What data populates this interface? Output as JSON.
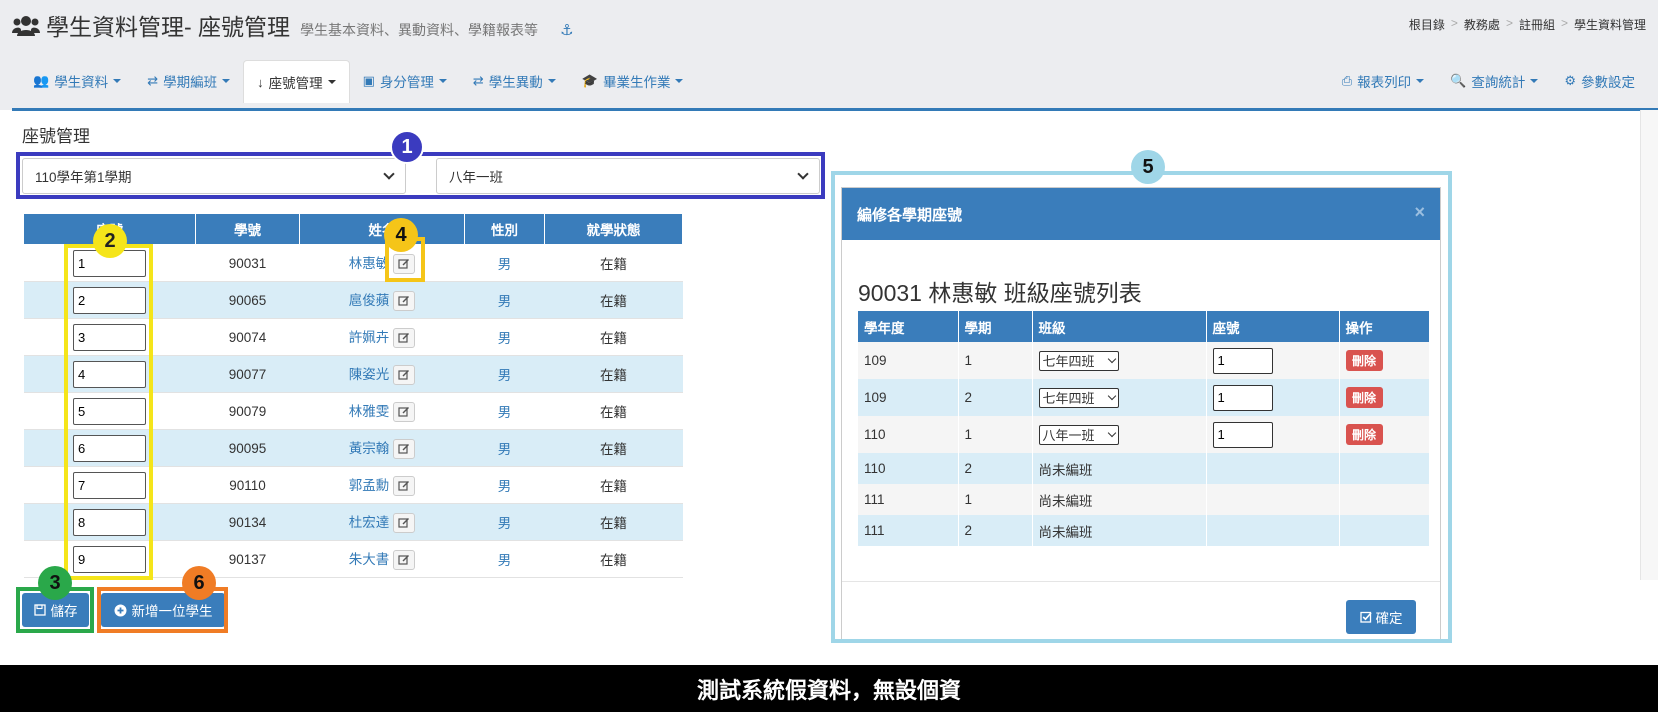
{
  "header": {
    "title": "學生資料管理- 座號管理",
    "subtitle": "學生基本資料、異動資料、學籍報表等",
    "anchor_icon": "anchor-icon",
    "breadcrumb": [
      "根目錄",
      "教務處",
      "註冊組",
      "學生資料管理"
    ]
  },
  "nav": {
    "left": [
      {
        "label": "學生資料",
        "icon": "users-icon",
        "glyph": "👥"
      },
      {
        "label": "學期編班",
        "icon": "shuffle-icon",
        "glyph": "⇄"
      },
      {
        "label": "座號管理",
        "icon": "sort-number-icon",
        "glyph": "↓"
      },
      {
        "label": "身分管理",
        "icon": "id-card-icon",
        "glyph": "▣"
      },
      {
        "label": "學生異動",
        "icon": "exchange-icon",
        "glyph": "⇄"
      },
      {
        "label": "畢業生作業",
        "icon": "graduation-cap-icon",
        "glyph": "🎓"
      }
    ],
    "right": [
      {
        "label": "報表列印",
        "icon": "print-icon",
        "glyph": "⎙"
      },
      {
        "label": "查詢統計",
        "icon": "search-icon",
        "glyph": "🔍"
      },
      {
        "label": "參數設定",
        "icon": "gear-icon",
        "glyph": "⚙"
      }
    ]
  },
  "section": {
    "title": "座號管理",
    "semester_select": "110學年第1學期",
    "class_select": "八年一班"
  },
  "table": {
    "headers": [
      "座號",
      "學號",
      "姓名",
      "性別",
      "就學狀態"
    ],
    "rows": [
      {
        "seat": "1",
        "id": "90031",
        "name": "林惠敏",
        "gender": "男",
        "status": "在籍"
      },
      {
        "seat": "2",
        "id": "90065",
        "name": "扈俊蘋",
        "gender": "男",
        "status": "在籍"
      },
      {
        "seat": "3",
        "id": "90074",
        "name": "許姵卉",
        "gender": "男",
        "status": "在籍"
      },
      {
        "seat": "4",
        "id": "90077",
        "name": "陳姿光",
        "gender": "男",
        "status": "在籍"
      },
      {
        "seat": "5",
        "id": "90079",
        "name": "林雅雯",
        "gender": "男",
        "status": "在籍"
      },
      {
        "seat": "6",
        "id": "90095",
        "name": "黃宗翰",
        "gender": "男",
        "status": "在籍"
      },
      {
        "seat": "7",
        "id": "90110",
        "name": "郭孟勳",
        "gender": "男",
        "status": "在籍"
      },
      {
        "seat": "8",
        "id": "90134",
        "name": "杜宏達",
        "gender": "男",
        "status": "在籍"
      },
      {
        "seat": "9",
        "id": "90137",
        "name": "朱大書",
        "gender": "男",
        "status": "在籍"
      }
    ]
  },
  "buttons": {
    "save": "儲存",
    "add_student": "新增一位學生"
  },
  "modal": {
    "title": "編修各學期座號",
    "close": "×",
    "heading": "90031 林惠敏 班級座號列表",
    "headers": [
      "學年度",
      "學期",
      "班級",
      "座號",
      "操作"
    ],
    "rows": [
      {
        "year": "109",
        "term": "1",
        "class": "七年四班",
        "seat": "1",
        "action": "刪除"
      },
      {
        "year": "109",
        "term": "2",
        "class": "七年四班",
        "seat": "1",
        "action": "刪除"
      },
      {
        "year": "110",
        "term": "1",
        "class": "八年一班",
        "seat": "1",
        "action": "刪除"
      },
      {
        "year": "110",
        "term": "2",
        "class": "尚未編班",
        "seat": "",
        "action": ""
      },
      {
        "year": "111",
        "term": "1",
        "class": "尚未編班",
        "seat": "",
        "action": ""
      },
      {
        "year": "111",
        "term": "2",
        "class": "尚未編班",
        "seat": "",
        "action": ""
      }
    ],
    "confirm": "確定"
  },
  "annotations": [
    {
      "num": "1",
      "color": "#3b3bbf"
    },
    {
      "num": "2",
      "color": "#f5e51a"
    },
    {
      "num": "3",
      "color": "#2aa84a"
    },
    {
      "num": "4",
      "color": "#f5c518"
    },
    {
      "num": "5",
      "color": "#9fd6e8"
    },
    {
      "num": "6",
      "color": "#f07c25"
    }
  ],
  "banner": "測試系統假資料，無設個資",
  "colors": {
    "primary": "#3a7dbb",
    "row_alt": "#d9edf7",
    "danger": "#d9534f"
  }
}
